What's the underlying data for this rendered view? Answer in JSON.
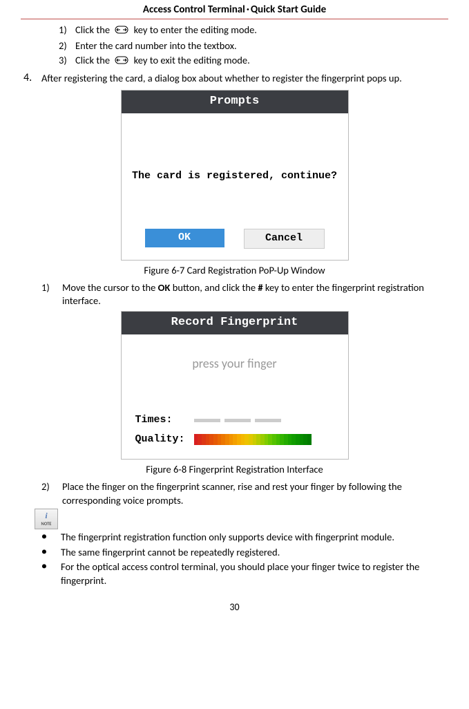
{
  "header": {
    "title_left": "Access Control Terminal",
    "separator": "·",
    "title_right": "Quick Start Guide"
  },
  "steps": {
    "s1_num": "1)",
    "s1_a": "Click the ",
    "s1_b": " key to enter the editing mode.",
    "s2_num": "2)",
    "s2": "Enter the card number into the textbox.",
    "s3_num": "3)",
    "s3_a": "Click the ",
    "s3_b": " key to exit the editing mode."
  },
  "main4": {
    "num": "4.",
    "text": "After registering the card, a dialog box about whether to register the fingerprint pops up."
  },
  "dialog1": {
    "title": "Prompts",
    "message": "The card is registered, continue?",
    "ok": "OK",
    "cancel": "Cancel"
  },
  "fig1": "Figure 6-7 Card Registration PoP-Up Window",
  "sub1": {
    "num": "1)",
    "a": "Move the cursor to the ",
    "ok": "OK",
    "b": " button, and click the ",
    "hash": "#",
    "c": " key to enter the fingerprint registration interface."
  },
  "dialog2": {
    "title": "Record Fingerprint",
    "press": "press your finger",
    "times": "Times:",
    "quality": "Quality:"
  },
  "fig2": "Figure 6-8 Fingerprint Registration Interface",
  "sub2": {
    "num": "2)",
    "text": "Place the finger on the fingerprint scanner, rise and rest your finger by following the corresponding voice prompts."
  },
  "note_label": "NOTE",
  "bullets": {
    "b1": "The fingerprint registration function only supports device with fingerprint module.",
    "b2": "The same fingerprint cannot be repeatedly registered.",
    "b3": "For the optical access control terminal, you should place your finger twice to register the fingerprint."
  },
  "page_num": "30"
}
